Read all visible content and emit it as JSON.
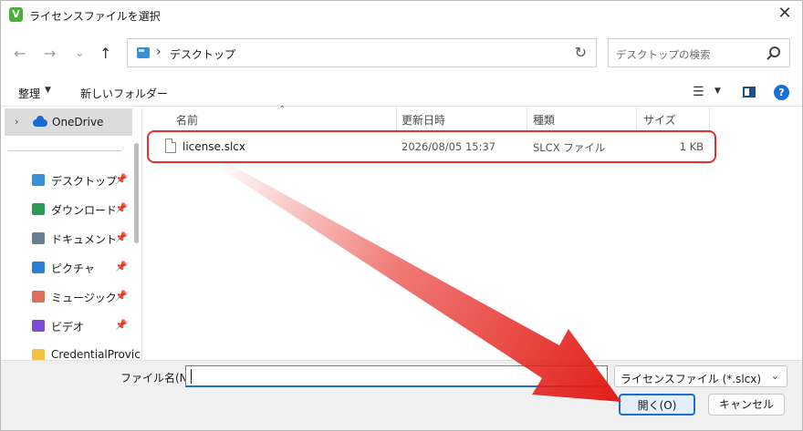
{
  "window": {
    "title": "ライセンスファイルを選択",
    "app_icon_letter": "V",
    "close_glyph": "✕"
  },
  "nav": {
    "back_glyph": "←",
    "forward_glyph": "→",
    "recent_glyph": "⌄",
    "up_glyph": "↑",
    "refresh_glyph": "↻",
    "breadcrumb_sep": "›",
    "breadcrumb": "デスクトップ",
    "search_placeholder": "デスクトップの検索"
  },
  "toolbar": {
    "organize": "整理",
    "dropdown_glyph": "▼",
    "new_folder": "新しいフォルダー",
    "view_glyph": "☰",
    "help_glyph": "?"
  },
  "sidebar": {
    "onedrive_label": "OneDrive",
    "expand_glyph": "›",
    "pin_glyph": "📌",
    "items": [
      {
        "label": "デスクトップ",
        "icon": "desktop-icon",
        "color": "#3a8fd6",
        "pinned": true
      },
      {
        "label": "ダウンロード",
        "icon": "download-icon",
        "color": "#2e9b55",
        "pinned": true
      },
      {
        "label": "ドキュメント",
        "icon": "document-icon",
        "color": "#6a7d92",
        "pinned": true
      },
      {
        "label": "ピクチャ",
        "icon": "pictures-icon",
        "color": "#2d7fd6",
        "pinned": true
      },
      {
        "label": "ミュージック",
        "icon": "music-icon",
        "color": "#e06d5a",
        "pinned": true
      },
      {
        "label": "ビデオ",
        "icon": "video-icon",
        "color": "#7a4bd6",
        "pinned": true
      },
      {
        "label": "CredentialProvic",
        "icon": "folder-icon",
        "color": "#f3c143",
        "pinned": false
      }
    ]
  },
  "file_list": {
    "sort_glyph": "⌃",
    "columns": {
      "name": "名前",
      "date": "更新日時",
      "type": "種類",
      "size": "サイズ"
    },
    "files": [
      {
        "name": "license.slcx",
        "date": "2026/08/05 15:37",
        "type": "SLCX ファイル",
        "size": "1 KB"
      }
    ]
  },
  "footer": {
    "filename_label": "ファイル名(N):",
    "filename_value": "",
    "filter_value": "ライセンスファイル (*.slcx)",
    "filter_glyph": "⌄",
    "open_button": "開く(O)",
    "cancel_button": "キャンセル"
  },
  "colors": {
    "accent": "#1a6fd0",
    "annotation_red": "#e8302a"
  }
}
